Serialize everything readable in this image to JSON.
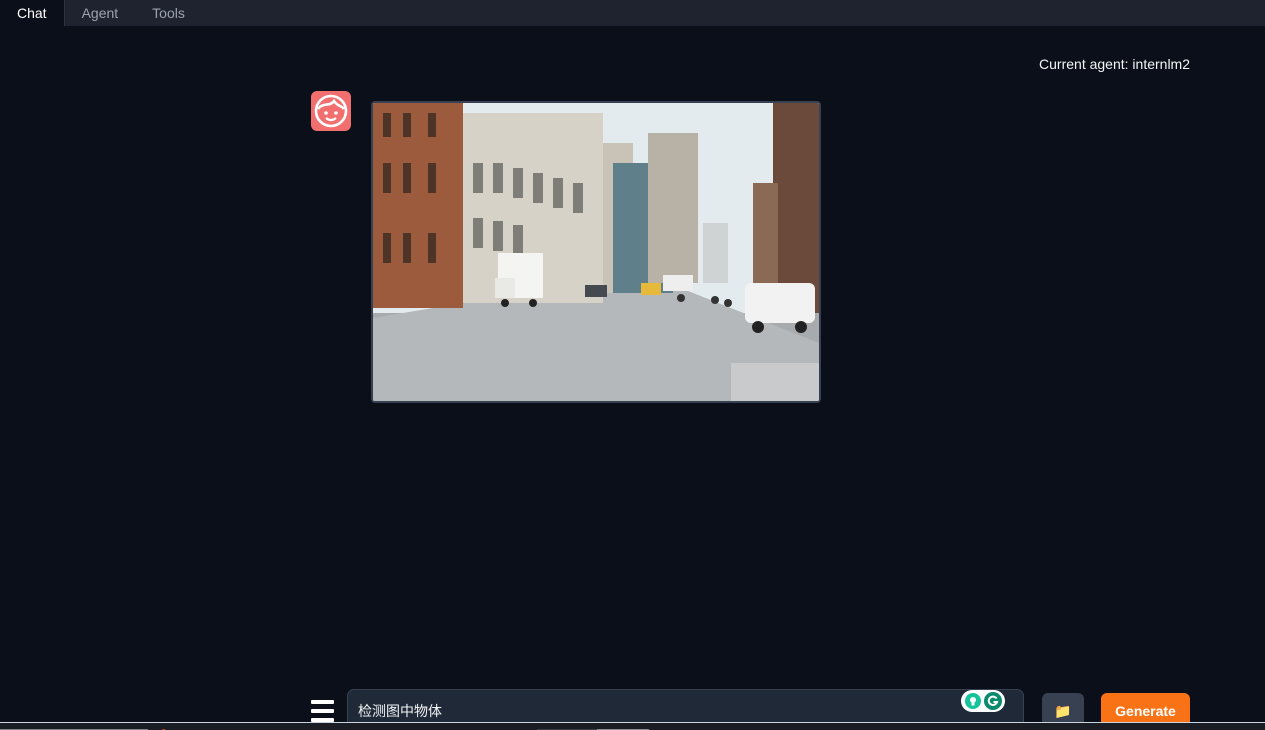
{
  "tabs": [
    {
      "label": "Chat",
      "active": true
    },
    {
      "label": "Agent",
      "active": false
    },
    {
      "label": "Tools",
      "active": false
    }
  ],
  "agent_status": "Current agent: internlm2",
  "chat": {
    "message_image": "street-scene-photo",
    "avatar_icon": "face-icon"
  },
  "input": {
    "value": "检测图中物体"
  },
  "buttons": {
    "upload_icon": "📁",
    "generate_label": "Generate"
  },
  "colors": {
    "background": "#0b0f19",
    "accent": "#f97316",
    "avatar": "#f26f6f"
  }
}
